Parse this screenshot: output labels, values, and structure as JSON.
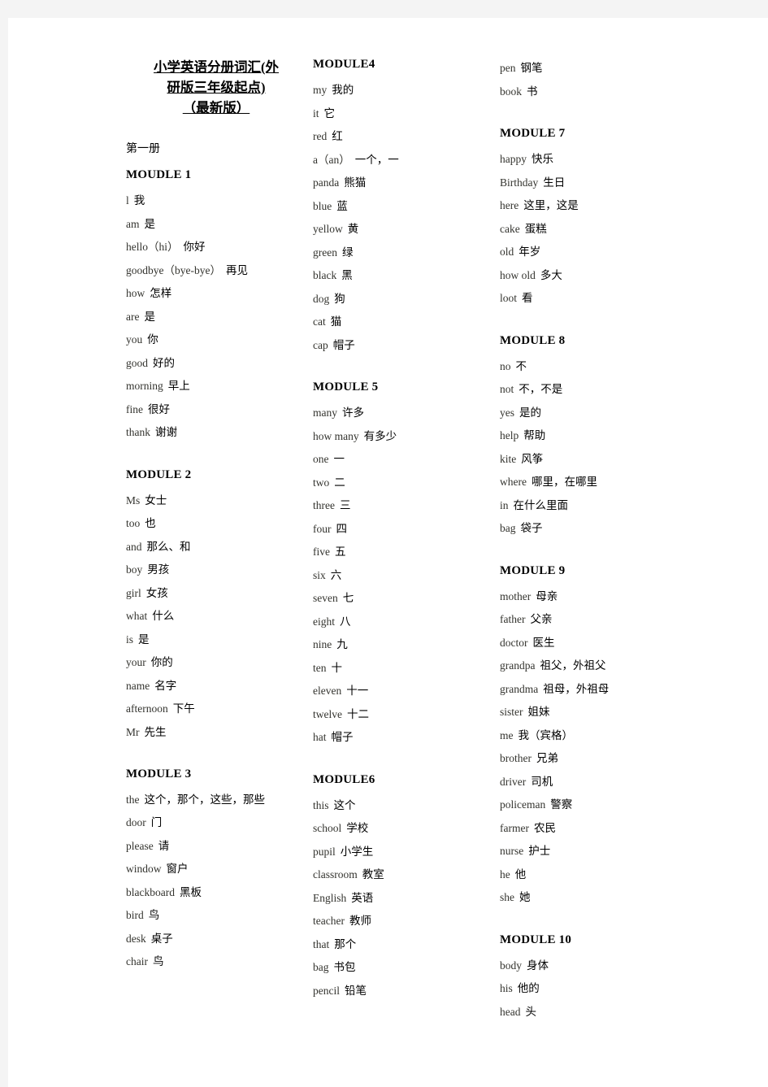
{
  "document": {
    "title_lines": [
      "小学英语分册词汇(外",
      "研版三年级起点)",
      "（最新版）"
    ],
    "volume_label": "第一册"
  },
  "columns": [
    {
      "id": "column-1",
      "blocks": [
        {
          "heading": "MOUDLE 1",
          "entries": [
            {
              "en": "l",
              "cn": "我"
            },
            {
              "en": "am",
              "cn": "是"
            },
            {
              "en": "hello（hi）",
              "cn": "你好"
            },
            {
              "en": "goodbye（bye-bye）",
              "cn": "再见"
            },
            {
              "en": "how",
              "cn": "怎样"
            },
            {
              "en": "are",
              "cn": "是"
            },
            {
              "en": "you",
              "cn": "你"
            },
            {
              "en": "good",
              "cn": "好的"
            },
            {
              "en": "morning",
              "cn": "早上"
            },
            {
              "en": "fine",
              "cn": "很好"
            },
            {
              "en": "thank",
              "cn": "谢谢"
            }
          ]
        },
        {
          "heading": "MODULE 2",
          "entries": [
            {
              "en": "Ms",
              "cn": "女士"
            },
            {
              "en": "too",
              "cn": "也"
            },
            {
              "en": "and",
              "cn": "那么、和"
            },
            {
              "en": "boy",
              "cn": "男孩"
            },
            {
              "en": "girl",
              "cn": "女孩"
            },
            {
              "en": "what",
              "cn": "什么"
            },
            {
              "en": "is",
              "cn": "是"
            },
            {
              "en": "your",
              "cn": "你的"
            },
            {
              "en": "name",
              "cn": "名字"
            },
            {
              "en": "afternoon",
              "cn": "下午"
            },
            {
              "en": "Mr",
              "cn": "先生"
            }
          ]
        },
        {
          "heading": "MODULE 3",
          "entries": [
            {
              "en": "the",
              "cn": "这个，那个，这些，那些",
              "wrap": true
            },
            {
              "en": "door",
              "cn": "门"
            },
            {
              "en": "please",
              "cn": "请"
            },
            {
              "en": "window",
              "cn": "窗户"
            },
            {
              "en": "blackboard",
              "cn": "黑板"
            },
            {
              "en": "bird",
              "cn": "鸟"
            },
            {
              "en": "desk",
              "cn": "桌子"
            },
            {
              "en": "chair",
              "cn": "鸟"
            }
          ]
        }
      ]
    },
    {
      "id": "column-2",
      "blocks": [
        {
          "heading": "MODULE4",
          "entries": [
            {
              "en": "my",
              "cn": "我的"
            },
            {
              "en": "it",
              "cn": "它"
            },
            {
              "en": "red",
              "cn": "红"
            },
            {
              "en": "a（an）",
              "cn": "一个，一"
            },
            {
              "en": "panda",
              "cn": "熊猫"
            },
            {
              "en": "blue",
              "cn": "蓝"
            },
            {
              "en": "yellow",
              "cn": "黄"
            },
            {
              "en": "green",
              "cn": "绿"
            },
            {
              "en": "black",
              "cn": "黑"
            },
            {
              "en": "dog",
              "cn": "狗"
            },
            {
              "en": "cat",
              "cn": "猫"
            },
            {
              "en": "cap",
              "cn": "帽子"
            }
          ]
        },
        {
          "heading": "MODULE 5",
          "entries": [
            {
              "en": "many",
              "cn": "许多"
            },
            {
              "en": "how many",
              "cn": "有多少"
            },
            {
              "en": "one",
              "cn": "一"
            },
            {
              "en": "two",
              "cn": "二"
            },
            {
              "en": "three",
              "cn": "三"
            },
            {
              "en": "four",
              "cn": "四"
            },
            {
              "en": "five",
              "cn": "五"
            },
            {
              "en": "six",
              "cn": "六"
            },
            {
              "en": "seven",
              "cn": "七"
            },
            {
              "en": "eight",
              "cn": "八"
            },
            {
              "en": "nine",
              "cn": "九"
            },
            {
              "en": "ten",
              "cn": "十"
            },
            {
              "en": "eleven",
              "cn": "十一"
            },
            {
              "en": "twelve",
              "cn": "十二"
            },
            {
              "en": "hat",
              "cn": "帽子"
            }
          ]
        },
        {
          "heading": "MODULE6",
          "entries": [
            {
              "en": "this",
              "cn": "这个"
            },
            {
              "en": "school",
              "cn": "学校"
            },
            {
              "en": "pupil",
              "cn": "小学生"
            },
            {
              "en": "classroom",
              "cn": "教室"
            },
            {
              "en": "English",
              "cn": "英语"
            },
            {
              "en": "teacher",
              "cn": "教师"
            },
            {
              "en": "that",
              "cn": "那个"
            },
            {
              "en": "bag",
              "cn": "书包"
            },
            {
              "en": "pencil",
              "cn": "铅笔"
            }
          ]
        }
      ]
    },
    {
      "id": "column-3",
      "blocks": [
        {
          "heading": null,
          "entries": [
            {
              "en": "pen",
              "cn": "钢笔"
            },
            {
              "en": "book",
              "cn": "书"
            }
          ]
        },
        {
          "heading": "MODULE 7",
          "entries": [
            {
              "en": "happy",
              "cn": "快乐"
            },
            {
              "en": "Birthday",
              "cn": "生日"
            },
            {
              "en": "here",
              "cn": "这里，这是"
            },
            {
              "en": "cake",
              "cn": "蛋糕"
            },
            {
              "en": "old",
              "cn": "年岁"
            },
            {
              "en": "how old",
              "cn": "多大"
            },
            {
              "en": "loot",
              "cn": "看"
            }
          ]
        },
        {
          "heading": "MODULE 8",
          "entries": [
            {
              "en": "no",
              "cn": "不"
            },
            {
              "en": "not",
              "cn": "不，不是"
            },
            {
              "en": "yes",
              "cn": "是的"
            },
            {
              "en": "help",
              "cn": "帮助"
            },
            {
              "en": "kite",
              "cn": "风筝"
            },
            {
              "en": "where",
              "cn": "哪里，在哪里"
            },
            {
              "en": "in",
              "cn": "在什么里面"
            },
            {
              "en": "bag",
              "cn": "袋子"
            }
          ]
        },
        {
          "heading": "MODULE 9",
          "entries": [
            {
              "en": "mother",
              "cn": "母亲"
            },
            {
              "en": "father",
              "cn": "父亲"
            },
            {
              "en": "doctor",
              "cn": "医生"
            },
            {
              "en": "grandpa",
              "cn": "祖父，外祖父"
            },
            {
              "en": "grandma",
              "cn": "祖母，外祖母"
            },
            {
              "en": "sister",
              "cn": "姐妹"
            },
            {
              "en": "me",
              "cn": "我（宾格）"
            },
            {
              "en": "brother",
              "cn": "兄弟"
            },
            {
              "en": "driver",
              "cn": "司机"
            },
            {
              "en": "policeman",
              "cn": "警察"
            },
            {
              "en": "farmer",
              "cn": "农民"
            },
            {
              "en": "nurse",
              "cn": "护士"
            },
            {
              "en": "he",
              "cn": "他"
            },
            {
              "en": "she",
              "cn": "她"
            }
          ]
        },
        {
          "heading": "MODULE 10",
          "entries": [
            {
              "en": "body",
              "cn": "身体"
            },
            {
              "en": "his",
              "cn": "他的"
            },
            {
              "en": "head",
              "cn": "头"
            }
          ]
        }
      ]
    }
  ]
}
